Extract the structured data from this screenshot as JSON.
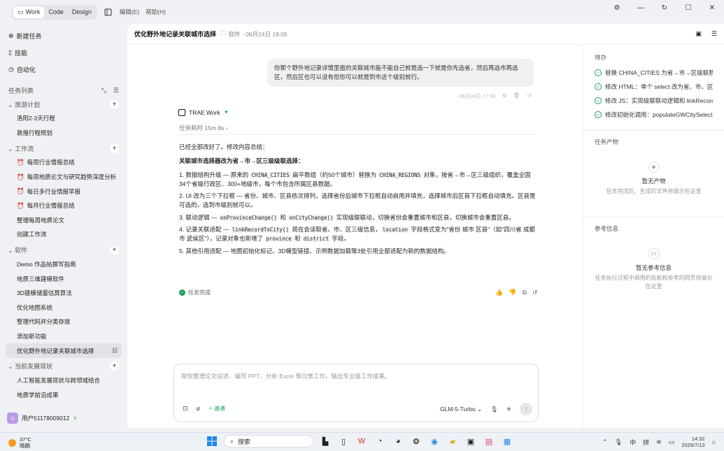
{
  "topbar": {
    "modes": [
      {
        "label": "Work",
        "active": true
      },
      {
        "label": "Code"
      },
      {
        "label": "Design"
      }
    ],
    "menus": [
      "编辑(E)",
      "帮助(H)"
    ]
  },
  "sidebar": {
    "top": [
      {
        "label": "新建任务",
        "icon": "plus-circle-icon"
      },
      {
        "label": "技能",
        "icon": "book-icon"
      },
      {
        "label": "自动化",
        "icon": "clock-icon"
      }
    ],
    "list_title": "任务列表",
    "groups": [
      {
        "label": "旅游计划",
        "items": [
          {
            "label": "洛阳2-3天行程"
          },
          {
            "label": "敦煌行程规划"
          }
        ]
      },
      {
        "label": "工作流",
        "items": [
          {
            "label": "每周行业情报总结",
            "icon": true
          },
          {
            "label": "每周地质论文与研究趋势深度分析",
            "icon": true
          },
          {
            "label": "每日多行业情报早报",
            "icon": true
          },
          {
            "label": "每月行业情报总结",
            "icon": true
          },
          {
            "label": "整理每周地质论文"
          },
          {
            "label": "创建工作流"
          }
        ]
      },
      {
        "label": "软件",
        "items": [
          {
            "label": "Demo 作品帖撰写指南"
          },
          {
            "label": "地质三维建模软件"
          },
          {
            "label": "3D建模储量估算算法"
          },
          {
            "label": "优化地图系统"
          },
          {
            "label": "整理代码并分类存放"
          },
          {
            "label": "添加新功能"
          },
          {
            "label": "优化野外地记录关联城市选择",
            "selected": true
          }
        ]
      },
      {
        "label": "当前发展现状",
        "items": [
          {
            "label": "人工智能发展现状与跨领域结合"
          },
          {
            "label": "地质学前沿成果"
          }
        ]
      }
    ],
    "user": "用户51178009012"
  },
  "main": {
    "title": "优化野外地记录关联城市选择",
    "meta": "软件 · 06月24日 18:06",
    "user_message": "你那个野外地记录详情里面的关联城市能不能自己就是选一下就是你先选省，然后再选市再选区，然后区也可以没有但你可以就是到市这个级别就行。",
    "user_msg_time": "06月24日 17:58",
    "agent_name": "TRAE Work",
    "elapsed": "任务耗时 15m 8s",
    "answer_intro": "已经全部改好了。修改内容总结：",
    "answer_heading": "关联城市选择器改为省→市→区三级级联选择：",
    "points": [
      {
        "a": "1. 数据结构升级 — 原来的 ",
        "c1": "CHINA_CITIES",
        "b": " 扁平数组（约50个城市）替换为 ",
        "c2": "CHINA_REGIONS",
        "d": " 对象，按省→市→区三级组织，覆盖全国34个省级行政区、300+地级市，每个市包含所属区县数据。"
      },
      {
        "a": "2. UI 改为三个下拉框 — 省份、城市、区县依次排列，选择省份后城市下拉框自动启用并填充，选择城市后区县下拉框自动填充。区县是可选的，选到市级别就可以。"
      },
      {
        "a": "3. 联动逻辑 — ",
        "c1": "onProvinceChange()",
        "b": " 和 ",
        "c2": "onCityChange()",
        "d": " 实现级联联动，切换省份会重置城市和区县，切换城市会重置区县。"
      },
      {
        "a": "4. 记录关联适配 — ",
        "c1": "linkRecordToCity()",
        "b": " 现在会读取省、市、区三级信息，",
        "c2": "location",
        "d": " 字段格式变为\"省份 城市 区县\"（如\"四川省 成都市 武侯区\"），记录对象也新增了 ",
        "c3": "province",
        "e": " 和 ",
        "c4": "district",
        "f": " 字段。"
      },
      {
        "a": "5. 其他引用适配 — 地图初始化标记、3D模型链接、示例数据加载等3处引用全部适配为新的数据结构。"
      }
    ],
    "done_label": "任务完成",
    "composer_placeholder": "帮你整理论文综述、编写 PPT、分析 Excel 等日常工作，输出专业级工作成果。",
    "speed_label": "速通",
    "model": "GLM-5-Turbo"
  },
  "right": {
    "todo_title": "待办",
    "todos": [
      "替换 CHINA_CITIES 为省→市→区级联数据结构",
      "修改 HTML：单个 select 改为省、市、区三个下拉框",
      "修改 JS：实现级联联动逻辑和 linkRecordToCity",
      "修改初始化调用：populateGWCitySelect"
    ],
    "artifact_title": "任务产物",
    "artifact_empty_title": "暂无产物",
    "artifact_empty_desc": "任务完成后，生成的文件将展示在这里",
    "ref_title": "参考信息",
    "ref_empty_title": "暂无参考信息",
    "ref_empty_desc": "任务执行过程中调用的技能和参考的网页将展示在这里"
  },
  "taskbar": {
    "temp": "37°C",
    "weather": "晴朗",
    "search": "搜索",
    "ime1": "中",
    "ime2": "拼",
    "time": "14:32",
    "date": "2026/7/13"
  }
}
